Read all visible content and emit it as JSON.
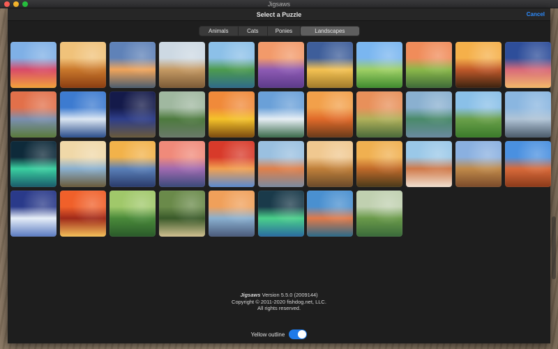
{
  "window": {
    "title": "Jigsaws"
  },
  "sheet": {
    "title": "Select a Puzzle",
    "cancel_label": "Cancel"
  },
  "tabs": [
    {
      "label": "Animals",
      "active": false
    },
    {
      "label": "Cats",
      "active": false
    },
    {
      "label": "Ponies",
      "active": false
    },
    {
      "label": "Landscapes",
      "active": true
    }
  ],
  "puzzles": [
    {
      "subject": "tulip fields with windmills",
      "palette": [
        "#7fb0e6",
        "#d84a6a",
        "#f2a23a"
      ]
    },
    {
      "subject": "autumn tree with fallen leaves",
      "palette": [
        "#f0c27a",
        "#c9782c",
        "#8a3d12"
      ]
    },
    {
      "subject": "sunset over marsh",
      "palette": [
        "#5f82b8",
        "#f0a45a",
        "#4b5c6e"
      ]
    },
    {
      "subject": "desert canyon",
      "palette": [
        "#cdd9e3",
        "#c59a64",
        "#7b5a36"
      ]
    },
    {
      "subject": "green lake landscape",
      "palette": [
        "#8cc0e8",
        "#4d9b4e",
        "#2f6a8a"
      ]
    },
    {
      "subject": "lavender field",
      "palette": [
        "#f29a6a",
        "#8e5bb4",
        "#5c3a8a"
      ]
    },
    {
      "subject": "golden sunset fields",
      "palette": [
        "#3e5e9a",
        "#f4c253",
        "#a07a2a"
      ]
    },
    {
      "subject": "green rolling hills",
      "palette": [
        "#7ab6f0",
        "#9fd065",
        "#3f8a2f"
      ]
    },
    {
      "subject": "sunset river",
      "palette": [
        "#f08c5a",
        "#8bb84a",
        "#3e6a38"
      ]
    },
    {
      "subject": "pagoda at sunset",
      "palette": [
        "#f5b04a",
        "#c0592a",
        "#3a2210"
      ]
    },
    {
      "subject": "hot air balloons",
      "palette": [
        "#2e4e9a",
        "#d86a7a",
        "#f2b86a"
      ]
    },
    {
      "subject": "mountain lake sunset",
      "palette": [
        "#e2704a",
        "#7a8fb0",
        "#5a7a3a"
      ]
    },
    {
      "subject": "snowy mountain reflection",
      "palette": [
        "#3d7bd0",
        "#dbe6f2",
        "#2a4d8a"
      ]
    },
    {
      "subject": "night sky over meadow",
      "palette": [
        "#141a4a",
        "#2e3e8a",
        "#6a5a3a"
      ]
    },
    {
      "subject": "forest stream",
      "palette": [
        "#a0b8a0",
        "#4d7a3e",
        "#6a7a6a"
      ]
    },
    {
      "subject": "sunflower field",
      "palette": [
        "#f08a3a",
        "#f4c22a",
        "#7a4a10"
      ]
    },
    {
      "subject": "alpine lake",
      "palette": [
        "#6aa0d8",
        "#e6eef4",
        "#3a6a4a"
      ]
    },
    {
      "subject": "desert cactus sunset",
      "palette": [
        "#f2a04a",
        "#e06a2a",
        "#6a3a1a"
      ]
    },
    {
      "subject": "green cliffs at sunset",
      "palette": [
        "#e8905a",
        "#b0b05a",
        "#4a6a3a"
      ]
    },
    {
      "subject": "karst mountains",
      "palette": [
        "#8ab0d0",
        "#4a8a6a",
        "#6a8aa0"
      ]
    },
    {
      "subject": "green mountain meadow",
      "palette": [
        "#8ac0e8",
        "#6aa04a",
        "#3a7a2a"
      ]
    },
    {
      "subject": "city skyline",
      "palette": [
        "#8ab6e0",
        "#b0c4d6",
        "#4a5a6a"
      ]
    },
    {
      "subject": "northern lights",
      "palette": [
        "#0e2a3a",
        "#3ad0a0",
        "#1a5a6a"
      ]
    },
    {
      "subject": "boardwalk at sunrise",
      "palette": [
        "#f0d8a8",
        "#8ab0d0",
        "#6a5a3a"
      ]
    },
    {
      "subject": "blue mountain sunset",
      "palette": [
        "#f2b24a",
        "#5a80b8",
        "#2a3a6a"
      ]
    },
    {
      "subject": "lamp posts at dusk",
      "palette": [
        "#f08a7a",
        "#a06ab0",
        "#3a4a7a"
      ]
    },
    {
      "subject": "red maple tree",
      "palette": [
        "#d83a2a",
        "#f2a050",
        "#5a8ad0"
      ]
    },
    {
      "subject": "golden gate bridge",
      "palette": [
        "#9ac0e0",
        "#e0804a",
        "#7a8aa0"
      ]
    },
    {
      "subject": "venice cathedral",
      "palette": [
        "#f0c890",
        "#c0803a",
        "#6a4a2a"
      ]
    },
    {
      "subject": "sunbeam forest",
      "palette": [
        "#f0b050",
        "#c06a2a",
        "#4a3a1a"
      ]
    },
    {
      "subject": "sea cliffs",
      "palette": [
        "#9ac8e8",
        "#d07a4a",
        "#f0e0d0"
      ]
    },
    {
      "subject": "canyon ruins",
      "palette": [
        "#8ab0e0",
        "#c08a4a",
        "#7a4a2a"
      ]
    },
    {
      "subject": "delicate arch",
      "palette": [
        "#4a90e0",
        "#d86a3a",
        "#8a3a1a"
      ]
    },
    {
      "subject": "snowy cabin at night",
      "palette": [
        "#2a3a8a",
        "#e6eef8",
        "#5a7ac0"
      ]
    },
    {
      "subject": "red forest canopy",
      "palette": [
        "#f0602a",
        "#a02a1a",
        "#f4c05a"
      ]
    },
    {
      "subject": "forest meadow",
      "palette": [
        "#a0c86a",
        "#4a8a3a",
        "#2a5a2a"
      ]
    },
    {
      "subject": "tree tunnel road",
      "palette": [
        "#6a8a4a",
        "#3a5a2a",
        "#d0c090"
      ]
    },
    {
      "subject": "pier at sunset",
      "palette": [
        "#f0a05a",
        "#8ab0d0",
        "#4a5a7a"
      ]
    },
    {
      "subject": "aurora over mountain",
      "palette": [
        "#1a3a4a",
        "#4ad08a",
        "#2a6aa0"
      ]
    },
    {
      "subject": "colorful coastal village",
      "palette": [
        "#4a90d0",
        "#e07a4a",
        "#2a6a8a"
      ]
    },
    {
      "subject": "green mountain valley",
      "palette": [
        "#c0d0b0",
        "#6a9a4a",
        "#3a6a3a"
      ]
    }
  ],
  "about": {
    "app_name": "Jigsaws",
    "version_text": "Version 5.5.0 (2009144)",
    "copyright": "Copyright © 2011-2020 fishdog.net, LLC.",
    "rights": "All rights reserved."
  },
  "settings": {
    "yellow_outline_label": "Yellow outline",
    "yellow_outline_on": true
  }
}
